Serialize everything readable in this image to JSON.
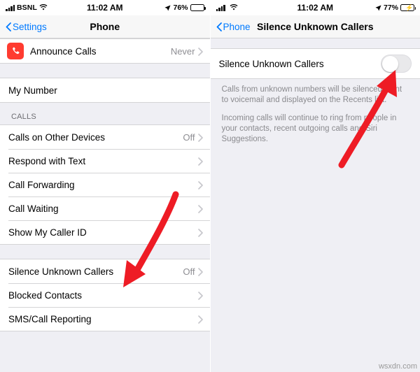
{
  "left": {
    "status": {
      "carrier": "BSNL",
      "time": "11:02 AM",
      "battery_pct": "76%"
    },
    "nav": {
      "back_label": "Settings",
      "title": "Phone"
    },
    "rows_top": [
      {
        "label": "Announce Calls",
        "value": "Never",
        "icon": "phone-announce-icon"
      }
    ],
    "rows_mynumber": [
      {
        "label": "My Number",
        "value": ""
      }
    ],
    "calls_header": "CALLS",
    "rows_calls": [
      {
        "label": "Calls on Other Devices",
        "value": "Off"
      },
      {
        "label": "Respond with Text",
        "value": ""
      },
      {
        "label": "Call Forwarding",
        "value": ""
      },
      {
        "label": "Call Waiting",
        "value": ""
      },
      {
        "label": "Show My Caller ID",
        "value": ""
      }
    ],
    "rows_bottom": [
      {
        "label": "Silence Unknown Callers",
        "value": "Off"
      },
      {
        "label": "Blocked Contacts",
        "value": ""
      },
      {
        "label": "SMS/Call Reporting",
        "value": ""
      }
    ]
  },
  "right": {
    "status": {
      "carrier": "",
      "time": "11:02 AM",
      "battery_pct": "77%"
    },
    "nav": {
      "back_label": "Phone",
      "title": "Silence Unknown Callers"
    },
    "toggle": {
      "label": "Silence Unknown Callers",
      "state": "off"
    },
    "footnotes": [
      "Calls from unknown numbers will be silenced, sent to voicemail and displayed on the Recents list.",
      "Incoming calls will continue to ring from people in your contacts, recent outgoing calls and Siri Suggestions."
    ]
  },
  "annotations": {
    "arrow_color": "#ee1c25",
    "arrow_left_name": "arrow-pointing-silence-unknown-callers",
    "arrow_right_name": "arrow-pointing-toggle"
  },
  "watermark": "wsxdn.com"
}
